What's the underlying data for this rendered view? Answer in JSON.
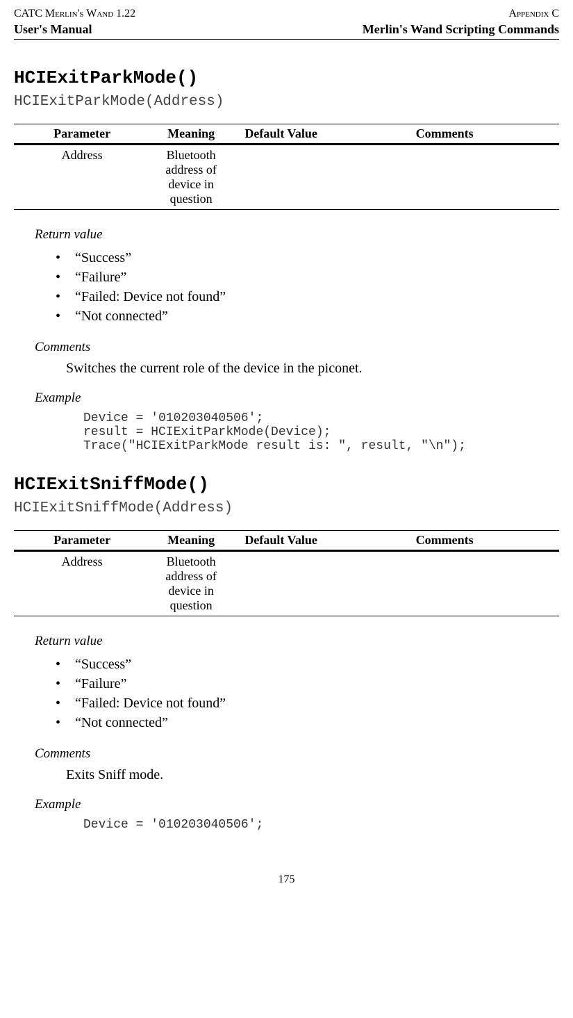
{
  "header": {
    "left1": "CATC Merlin's Wand 1.22",
    "left2": "User's Manual",
    "right1": "Appendix C",
    "right2": "Merlin's Wand Scripting Commands"
  },
  "tableHeaders": {
    "parameter": "Parameter",
    "meaning": "Meaning",
    "default": "Default Value",
    "comments": "Comments"
  },
  "labels": {
    "returnValue": "Return value",
    "comments": "Comments",
    "example": "Example"
  },
  "func1": {
    "title": "HCIExitParkMode()",
    "signature": "HCIExitParkMode(Address)",
    "param": "Address",
    "meaning": "Bluetooth address of device in question",
    "default": "",
    "commentsCell": "",
    "returns": [
      "“Success”",
      "“Failure”",
      "“Failed: Device not found”",
      "“Not connected”"
    ],
    "commentsText": "Switches the current role of the device in the piconet.",
    "example": "Device = '010203040506';\nresult = HCIExitParkMode(Device);\nTrace(\"HCIExitParkMode result is: \", result, \"\\n\");"
  },
  "func2": {
    "title": "HCIExitSniffMode()",
    "signature": "HCIExitSniffMode(Address)",
    "param": "Address",
    "meaning": "Bluetooth address of device in question",
    "default": "",
    "commentsCell": "",
    "returns": [
      "“Success”",
      "“Failure”",
      "“Failed: Device not found”",
      "“Not connected”"
    ],
    "commentsText": "Exits Sniff mode.",
    "example": "Device = '010203040506';"
  },
  "pageNumber": "175"
}
